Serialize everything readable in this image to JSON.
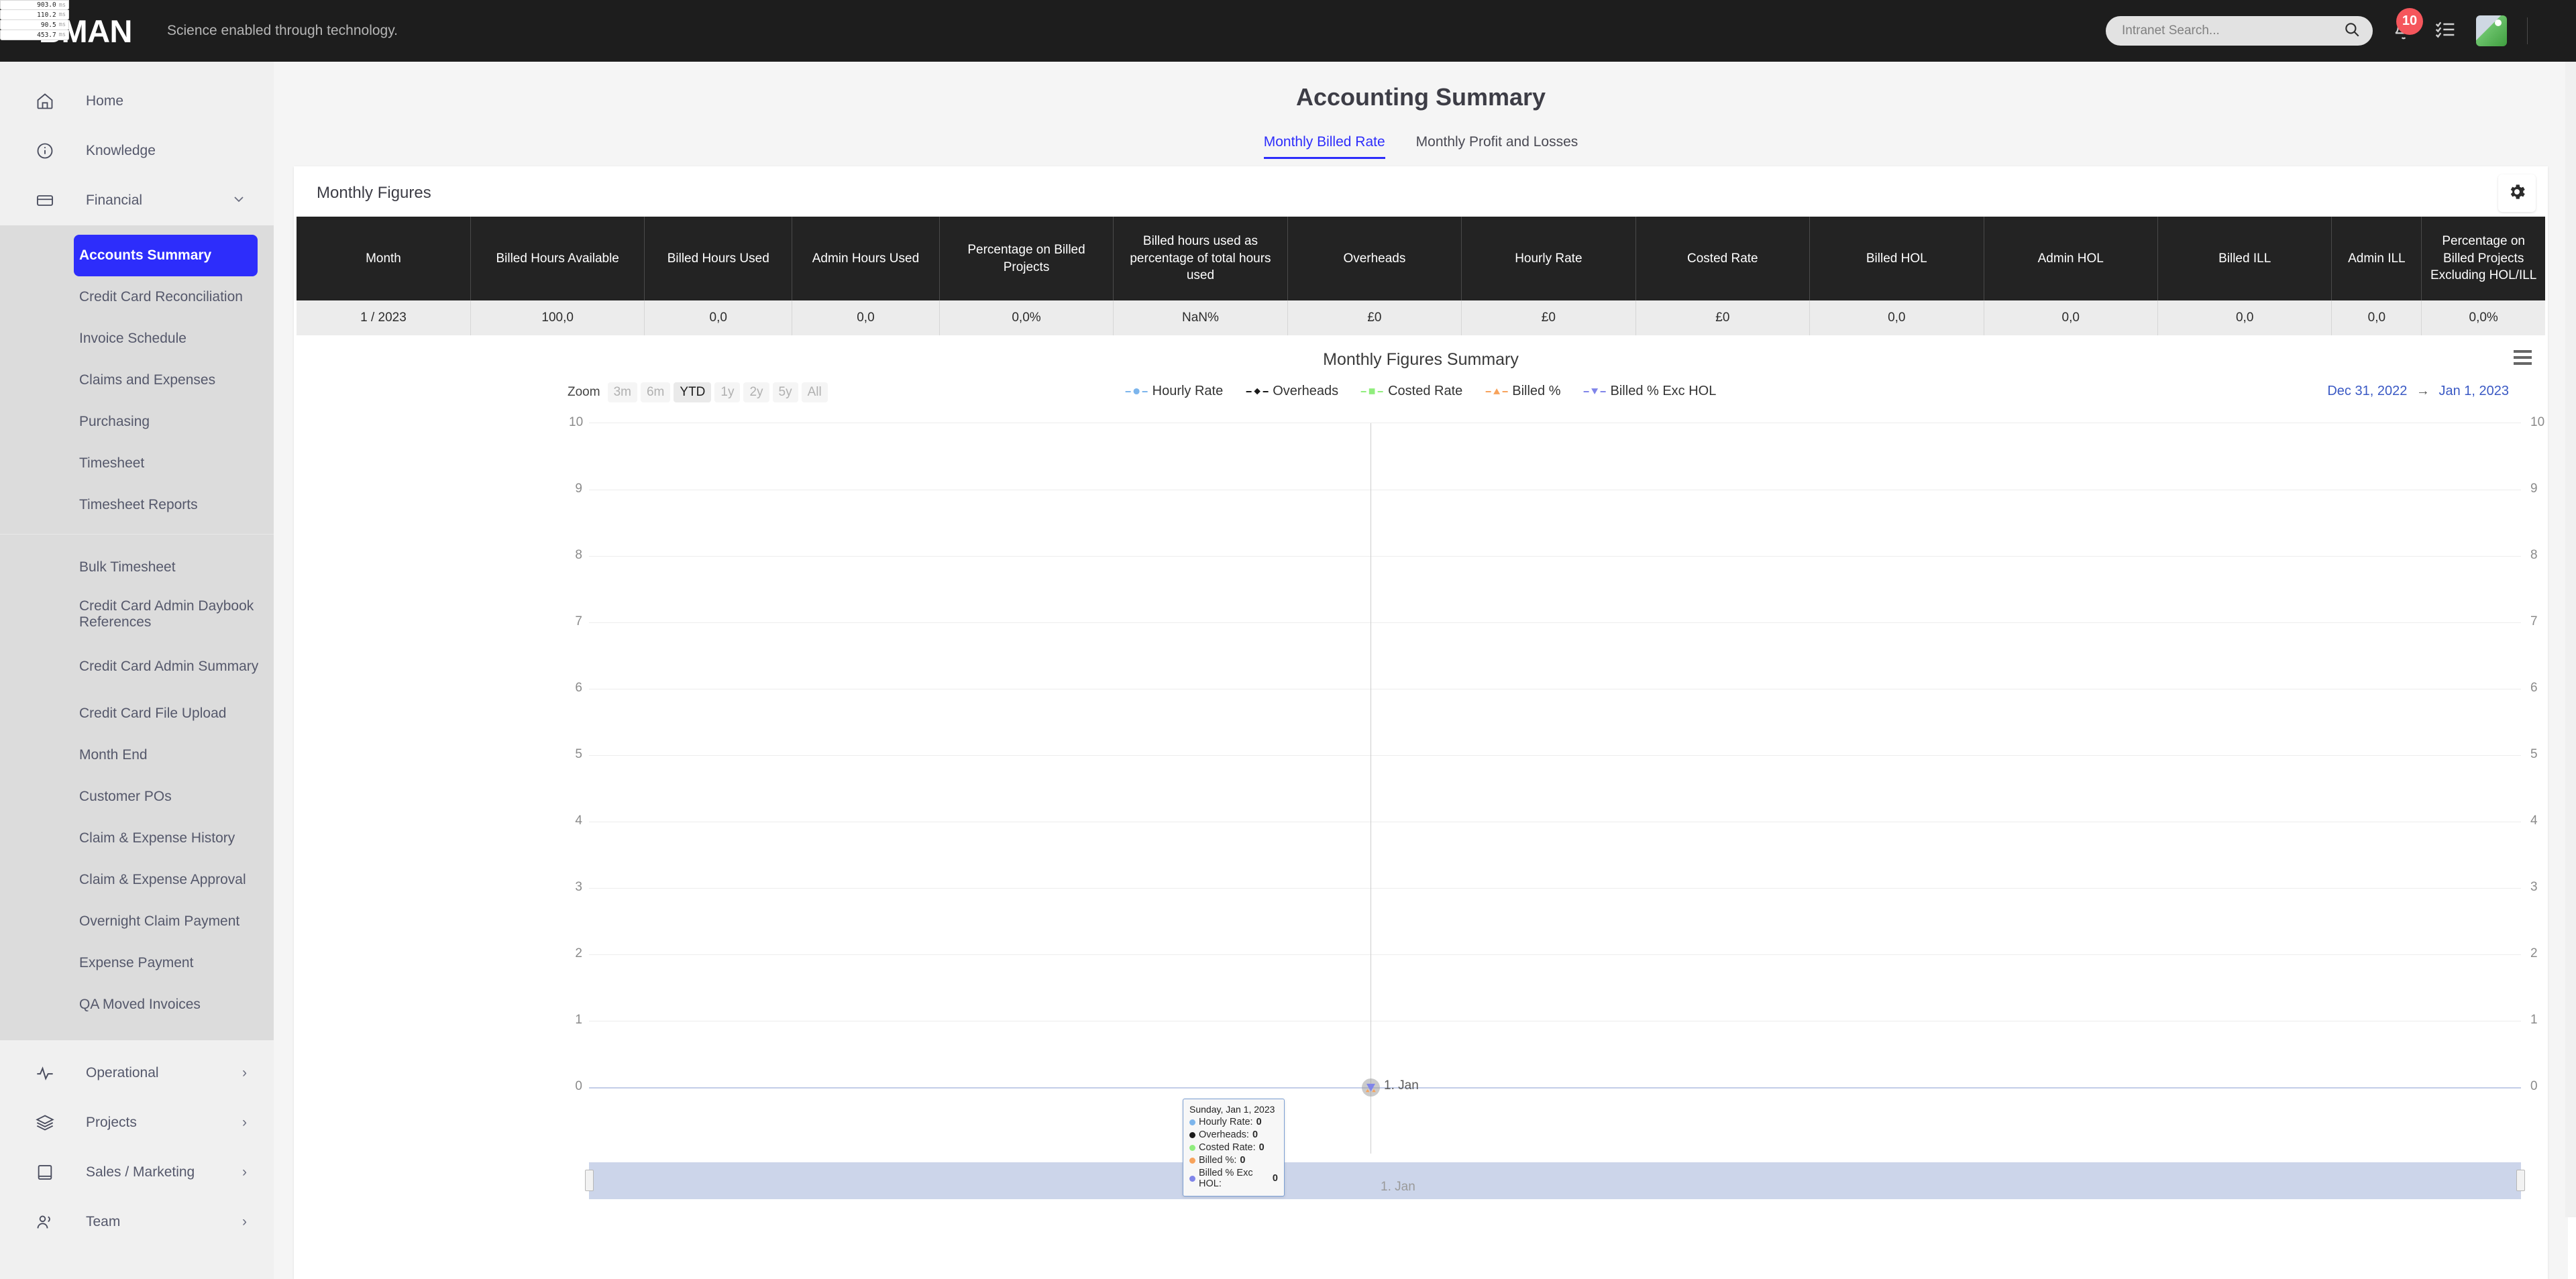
{
  "perf_overlay": {
    "unit": "ms",
    "rows": [
      "903.0",
      "110.2",
      "90.5",
      "453.7"
    ]
  },
  "topbar": {
    "logo": "BMAN",
    "tagline": "Science enabled through technology.",
    "search_placeholder": "Intranet Search...",
    "search_value": "",
    "notification_count": "10"
  },
  "sidebar": {
    "top_items": [
      {
        "label": "Home",
        "icon": "home-icon"
      },
      {
        "label": "Knowledge",
        "icon": "info-circle-icon"
      },
      {
        "label": "Financial",
        "icon": "credit-card-icon",
        "chevron": "⌄"
      }
    ],
    "financial_group_a": [
      "Accounts Summary",
      "Credit Card Reconciliation",
      "Invoice Schedule",
      "Claims and Expenses",
      "Purchasing",
      "Timesheet",
      "Timesheet Reports"
    ],
    "financial_group_b": [
      "Bulk Timesheet",
      "Credit Card Admin Daybook References",
      "Credit Card Admin Summary",
      "Credit Card File Upload",
      "Month End",
      "Customer POs",
      "Claim & Expense History",
      "Claim & Expense Approval",
      "Overnight Claim Payment",
      "Expense Payment",
      "QA Moved Invoices"
    ],
    "active_item": "Accounts Summary",
    "bottom_items": [
      {
        "label": "Operational",
        "icon": "activity-icon",
        "chevron": "›"
      },
      {
        "label": "Projects",
        "icon": "layers-icon",
        "chevron": "›"
      },
      {
        "label": "Sales / Marketing",
        "icon": "book-icon",
        "chevron": "›"
      },
      {
        "label": "Team",
        "icon": "users-icon",
        "chevron": "›"
      }
    ]
  },
  "main": {
    "page_title": "Accounting Summary",
    "tabs": [
      {
        "label": "Monthly Billed Rate",
        "active": true
      },
      {
        "label": "Monthly Profit and Losses",
        "active": false
      }
    ],
    "section_title": "Monthly Figures"
  },
  "table": {
    "headers": [
      "Month",
      "Billed Hours Available",
      "Billed Hours Used",
      "Admin Hours Used",
      "Percentage on Billed Projects",
      "Billed hours used as percentage of total hours used",
      "Overheads",
      "Hourly Rate",
      "Costed Rate",
      "Billed HOL",
      "Admin HOL",
      "Billed ILL",
      "Admin ILL",
      "Percentage on Billed Projects Excluding HOL/ILL"
    ],
    "rows": [
      [
        "1 / 2023",
        "100,0",
        "0,0",
        "0,0",
        "0,0%",
        "NaN%",
        "£0",
        "£0",
        "£0",
        "0,0",
        "0,0",
        "0,0",
        "0,0",
        "0,0%"
      ]
    ]
  },
  "chart_data": {
    "type": "line",
    "title": "Monthly Figures Summary",
    "xlabel": "",
    "ylabel": "",
    "ylim": [
      0,
      10
    ],
    "yticks": [
      0,
      1,
      2,
      3,
      4,
      5,
      6,
      7,
      8,
      9,
      10
    ],
    "grid": true,
    "legend_position": "top-center",
    "x": [
      "1. Jan"
    ],
    "x_tick_labels": [
      "1. Jan"
    ],
    "series": [
      {
        "name": "Hourly Rate",
        "values": [
          0
        ],
        "color": "#7cb5ec",
        "marker": "circle"
      },
      {
        "name": "Overheads",
        "values": [
          0
        ],
        "color": "#1a1a1a",
        "marker": "diamond"
      },
      {
        "name": "Costed Rate",
        "values": [
          0
        ],
        "color": "#90ed7d",
        "marker": "square"
      },
      {
        "name": "Billed %",
        "values": [
          0
        ],
        "color": "#f7a35c",
        "marker": "triangle"
      },
      {
        "name": "Billed % Exc HOL",
        "values": [
          0
        ],
        "color": "#8085e9",
        "marker": "triangle-down"
      }
    ],
    "zoom_label": "Zoom",
    "zoom_options": [
      {
        "label": "3m",
        "active": false
      },
      {
        "label": "6m",
        "active": false
      },
      {
        "label": "YTD",
        "active": true
      },
      {
        "label": "1y",
        "active": false
      },
      {
        "label": "2y",
        "active": false
      },
      {
        "label": "5y",
        "active": false
      },
      {
        "label": "All",
        "active": false
      }
    ],
    "range_from": "Dec 31, 2022",
    "range_arrow": "→",
    "range_to": "Jan 1, 2023",
    "navigator_label": "1. Jan",
    "tooltip": {
      "date": "Sunday, Jan 1, 2023",
      "rows": [
        {
          "label": "Hourly Rate:",
          "value": "0",
          "color": "#7cb5ec"
        },
        {
          "label": "Overheads:",
          "value": "0",
          "color": "#1a1a1a"
        },
        {
          "label": "Costed Rate:",
          "value": "0",
          "color": "#90ed7d"
        },
        {
          "label": "Billed %:",
          "value": "0",
          "color": "#f7a35c"
        },
        {
          "label": "Billed % Exc HOL:",
          "value": "0",
          "color": "#8085e9"
        }
      ]
    }
  }
}
